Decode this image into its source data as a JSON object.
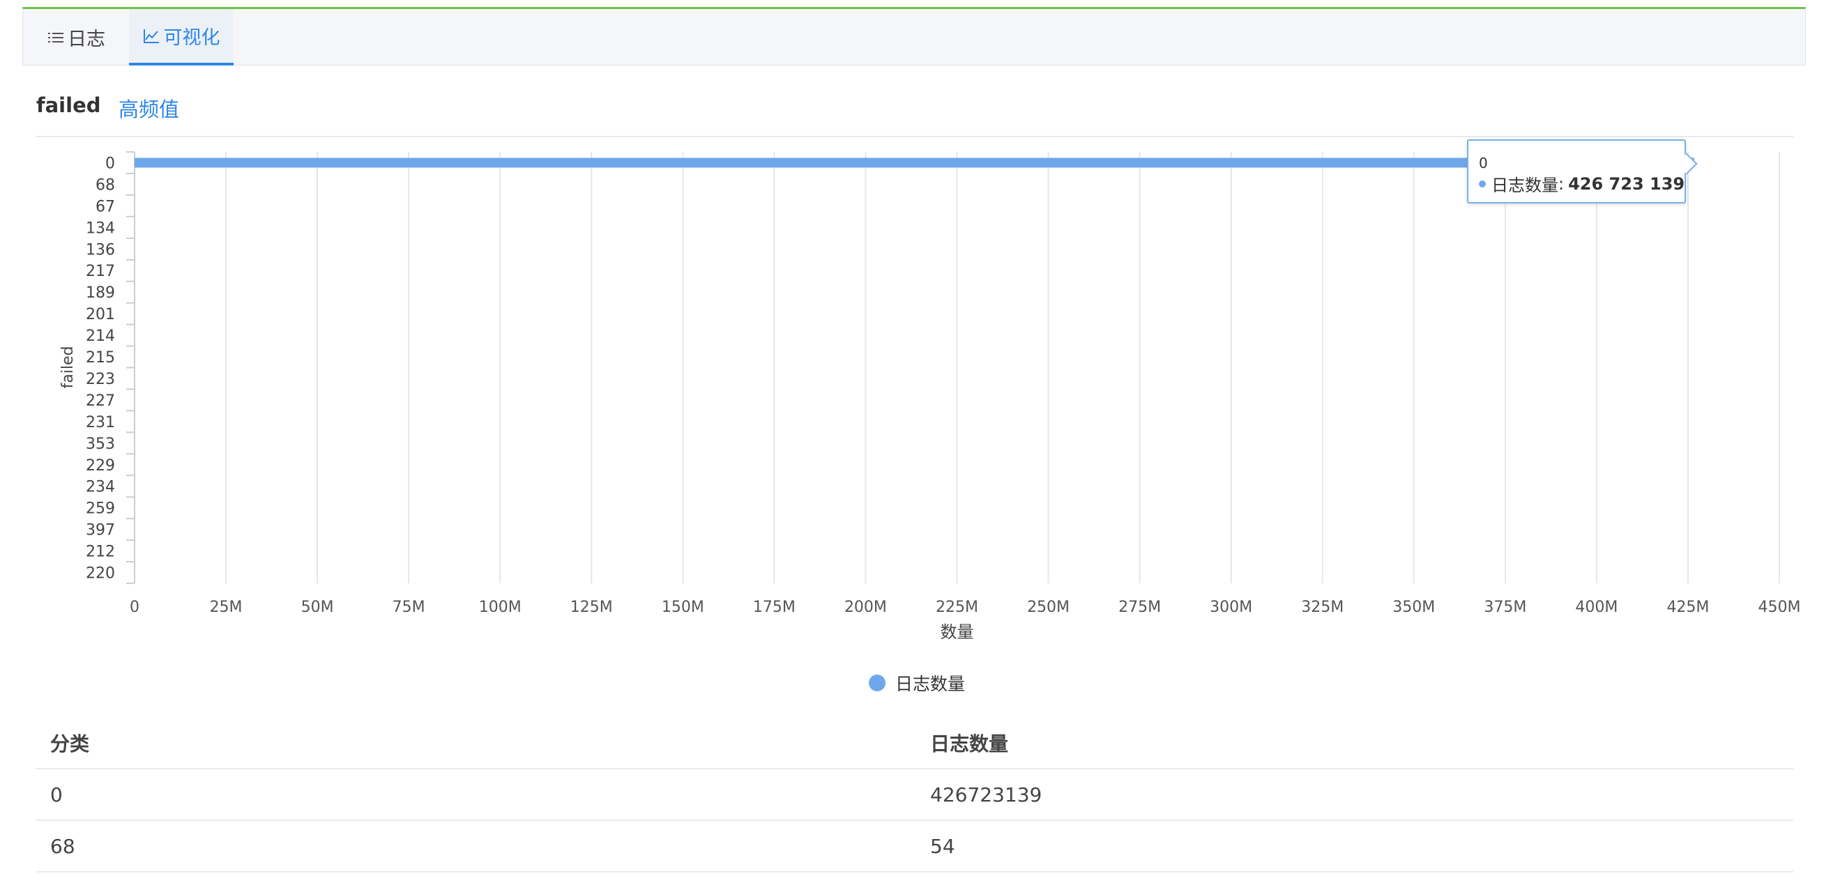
{
  "tabs": [
    {
      "label": "日志",
      "icon": "list-icon",
      "active": false
    },
    {
      "label": "可视化",
      "icon": "line-chart-icon",
      "active": true
    }
  ],
  "field_name": "failed",
  "subtab_label": "高频值",
  "chart_data": {
    "type": "bar",
    "orientation": "horizontal",
    "categories": [
      "0",
      "68",
      "67",
      "134",
      "136",
      "217",
      "189",
      "201",
      "214",
      "215",
      "223",
      "227",
      "231",
      "353",
      "229",
      "234",
      "259",
      "397",
      "212",
      "220"
    ],
    "series": [
      {
        "name": "日志数量",
        "values": [
          426723139,
          54,
          null,
          null,
          null,
          null,
          null,
          null,
          null,
          null,
          null,
          null,
          null,
          null,
          null,
          null,
          null,
          null,
          null,
          null
        ]
      }
    ],
    "xlabel": "数量",
    "ylabel": "failed",
    "xlim": [
      0,
      450000000
    ],
    "xticks": [
      "0",
      "25M",
      "50M",
      "75M",
      "100M",
      "125M",
      "150M",
      "175M",
      "200M",
      "225M",
      "250M",
      "275M",
      "300M",
      "325M",
      "350M",
      "375M",
      "400M",
      "425M",
      "450M"
    ],
    "grid": true,
    "legend": "bottom-center",
    "color": "#6fa8ea"
  },
  "tooltip": {
    "title": "0",
    "series": "日志数量",
    "value": "426 723 139"
  },
  "legend_label": "日志数量",
  "table": {
    "headers": [
      "分类",
      "日志数量"
    ],
    "rows": [
      [
        "0",
        "426723139"
      ],
      [
        "68",
        "54"
      ]
    ]
  }
}
